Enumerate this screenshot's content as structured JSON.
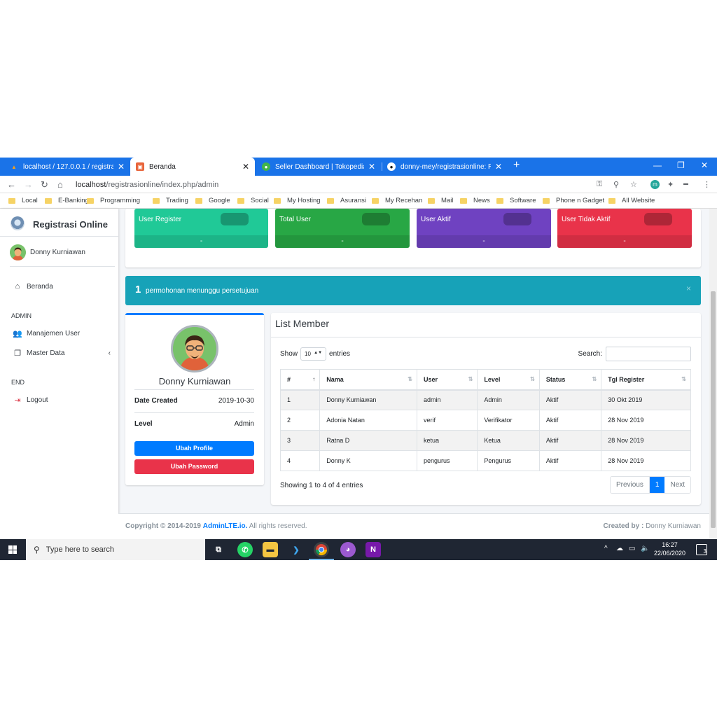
{
  "browser": {
    "tabs": [
      {
        "label": "localhost / 127.0.0.1 / registrasi_o",
        "icon": "phpmyadmin-icon"
      },
      {
        "label": "Beranda",
        "icon": "app-favicon-icon",
        "active": true
      },
      {
        "label": "Seller Dashboard | Tokopedia",
        "icon": "tokopedia-icon"
      },
      {
        "label": "donny-mey/registrasionline: Reg",
        "icon": "github-icon"
      }
    ],
    "url_host": "localhost",
    "url_path": "/registrasionline/index.php/admin",
    "bookmarks": [
      "Local",
      "E-Banking",
      "Programming",
      "Trading",
      "Google",
      "Social",
      "My Hosting",
      "Asuransi",
      "My Recehan",
      "Mail",
      "News",
      "Software",
      "Phone n Gadget",
      "All Website"
    ],
    "profile_initial": "m"
  },
  "sidebar": {
    "brand": "Registrasi Online",
    "user_name": "Donny Kurniawan",
    "items": [
      {
        "label": "Beranda",
        "icon": "home-icon"
      },
      {
        "header": "ADMIN"
      },
      {
        "label": "Manajemen User",
        "icon": "users-icon"
      },
      {
        "label": "Master Data",
        "icon": "copy-icon"
      },
      {
        "header": "END"
      },
      {
        "label": "Logout",
        "icon": "sign-out-icon"
      }
    ]
  },
  "infoboxes": [
    {
      "title": "User Register",
      "footer": "-",
      "color": "#20c997"
    },
    {
      "title": "Total User",
      "footer": "-",
      "color": "#28a745"
    },
    {
      "title": "User Aktif",
      "footer": "-",
      "color": "#6f42c1"
    },
    {
      "title": "User Tidak Aktif",
      "footer": "-",
      "color": "#dc3545"
    }
  ],
  "alert": {
    "count": "1",
    "message": "permohonan menunggu persetujuan",
    "close": "×"
  },
  "profile": {
    "name": "Donny Kurniawan",
    "date_created_label": "Date Created",
    "date_created": "2019-10-30",
    "level_label": "Level",
    "level": "Admin",
    "btn_profile": "Ubah Profile",
    "btn_password": "Ubah Password"
  },
  "members": {
    "title": "List Member",
    "show_label": "Show",
    "entries_value": "10",
    "entries_label": "entries",
    "search_label": "Search:",
    "columns": [
      "#",
      "Nama",
      "User",
      "Level",
      "Status",
      "Tgl Register"
    ],
    "rows": [
      [
        "1",
        "Donny Kurniawan",
        "admin",
        "Admin",
        "Aktif",
        "30 Okt 2019"
      ],
      [
        "2",
        "Adonia Natan",
        "verif",
        "Verifikator",
        "Aktif",
        "28 Nov 2019"
      ],
      [
        "3",
        "Ratna D",
        "ketua",
        "Ketua",
        "Aktif",
        "28 Nov 2019"
      ],
      [
        "4",
        "Donny K",
        "pengurus",
        "Pengurus",
        "Aktif",
        "28 Nov 2019"
      ]
    ],
    "info": "Showing 1 to 4 of 4 entries",
    "pager": {
      "prev": "Previous",
      "current": "1",
      "next": "Next"
    }
  },
  "footer": {
    "copyright": "Copyright © 2014-2019",
    "link": "AdminLTE.io.",
    "rights": "All rights reserved.",
    "created_by_label": "Created by :",
    "created_by": "Donny Kurniawan"
  },
  "taskbar": {
    "search_placeholder": "Type here to search",
    "time": "16:27",
    "date": "22/06/2020",
    "notifications": "3"
  },
  "colors": {
    "primary": "#007bff",
    "danger": "#dc3545",
    "info": "#17a2b8",
    "chrome": "#1a73e8"
  }
}
